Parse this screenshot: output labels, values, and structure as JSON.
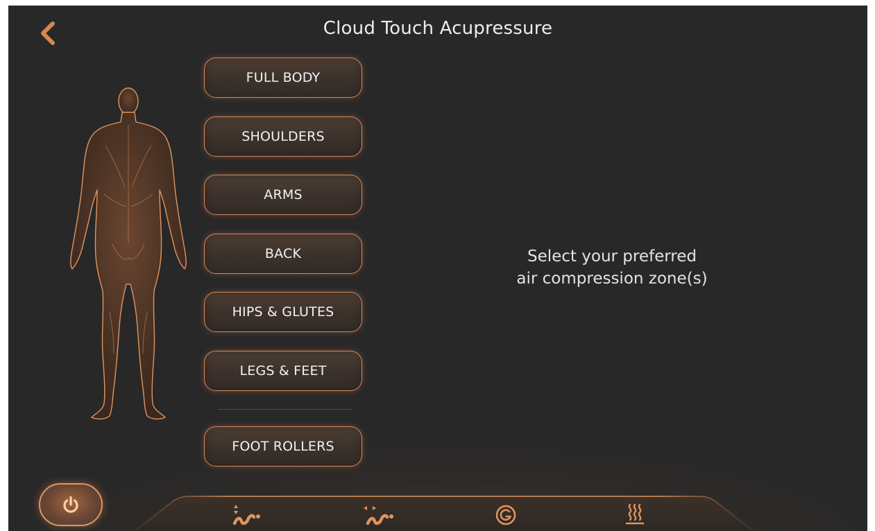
{
  "header": {
    "title": "Cloud Touch Acupressure",
    "back_icon": "chevron-left-icon"
  },
  "zones": [
    {
      "label": "FULL BODY"
    },
    {
      "label": "SHOULDERS"
    },
    {
      "label": "ARMS"
    },
    {
      "label": "BACK"
    },
    {
      "label": "HIPS & GLUTES"
    },
    {
      "label": "LEGS & FEET"
    },
    {
      "label": "FOOT ROLLERS"
    }
  ],
  "hint": {
    "line1": "Select your preferred",
    "line2": "air compression zone(s)"
  },
  "bottom_nav": {
    "power_icon": "power-icon",
    "tabs": [
      {
        "icon": "vertical-wave-icon"
      },
      {
        "icon": "horizontal-wave-icon"
      },
      {
        "icon": "g-force-icon"
      },
      {
        "icon": "heat-icon"
      }
    ]
  },
  "colors": {
    "accent": "#d9875a",
    "background": "#282828",
    "text": "#ececec"
  }
}
